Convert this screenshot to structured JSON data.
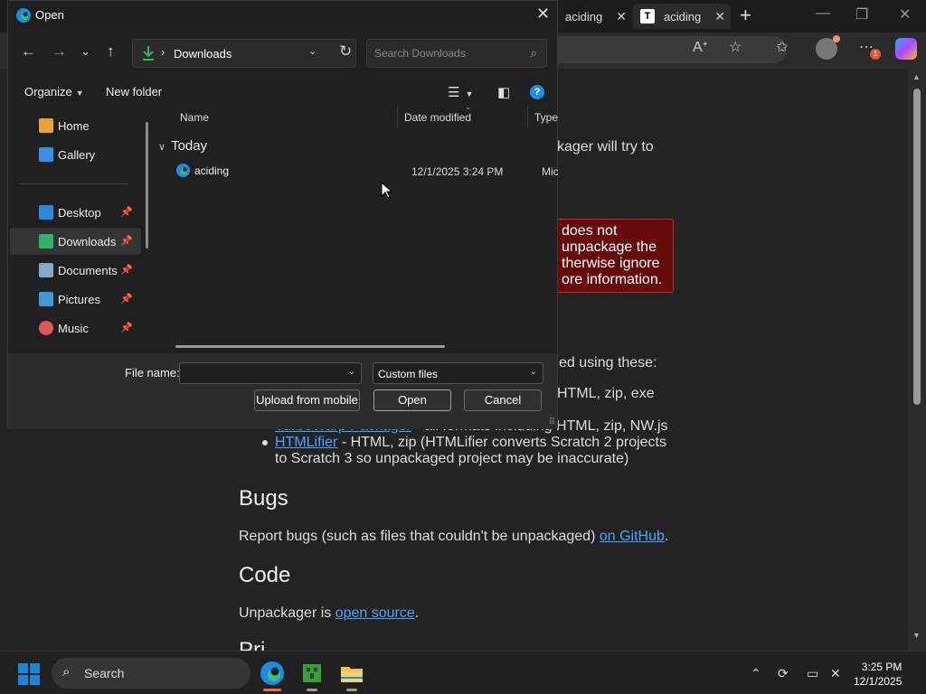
{
  "browser": {
    "tabs": [
      {
        "label": "aciding"
      },
      {
        "label": "aciding"
      }
    ],
    "new_tab": "+",
    "window_controls": {
      "minimize": "—",
      "maximize": "❐",
      "close": "✕"
    },
    "toolbar_icons": [
      "read-aloud-icon",
      "favorite-star-icon",
      "favorites-icon",
      "profile-icon",
      "more-icon",
      "copilot-icon"
    ],
    "notification_count": "1",
    "page": {
      "line1": "kager will try to",
      "warning_lines": [
        "does not",
        "unpackage the",
        "therwise ignore",
        "ore information."
      ],
      "used_using": "ed using these:",
      "list_fragment1": "HTML, zip, exe",
      "list_item2_link": "TurboWarp Packager",
      "list_item2_text": " - all formats including HTML, zip, NW.js",
      "list_item3_link": "HTMLifier",
      "list_item3_text": " - HTML, zip (HTMLifier converts Scratch 2 projects",
      "list_item3_text2": "to Scratch 3 so unpackaged project may be inaccurate)",
      "bugs_heading": "Bugs",
      "bugs_text": "Report bugs (such as files that couldn't be unpackaged) ",
      "bugs_link": "on GitHub",
      "bugs_end": ".",
      "code_heading": "Code",
      "code_text": "Unpackager is ",
      "code_link": "open source",
      "code_end": ".",
      "next_heading_fragment": "Pri"
    }
  },
  "dialog": {
    "title": "Open",
    "close": "✕",
    "nav": {
      "back": "←",
      "forward": "→",
      "recent": "⌄",
      "up": "↑"
    },
    "path": {
      "chevron": "›",
      "folder": "Downloads",
      "dropdown": "⌄",
      "refresh": "↻"
    },
    "search": {
      "placeholder": "Search Downloads"
    },
    "commands": {
      "organize": "Organize",
      "new_folder": "New folder"
    },
    "nav_pane": [
      {
        "label": "Home",
        "icon": "home-icon",
        "color": "#e8a33c",
        "pinned": false
      },
      {
        "label": "Gallery",
        "icon": "gallery-icon",
        "color": "#3a8ee6",
        "pinned": false
      },
      {
        "label": "Desktop",
        "icon": "desktop-icon",
        "color": "#2b8ae0",
        "pinned": true
      },
      {
        "label": "Downloads",
        "icon": "downloads-icon",
        "color": "#2fb36a",
        "pinned": true,
        "selected": true
      },
      {
        "label": "Documents",
        "icon": "documents-icon",
        "color": "#8aa6c8",
        "pinned": true
      },
      {
        "label": "Pictures",
        "icon": "pictures-icon",
        "color": "#3a9ad9",
        "pinned": true
      },
      {
        "label": "Music",
        "icon": "music-icon",
        "color": "#e0565a",
        "pinned": true
      }
    ],
    "columns": {
      "name": "Name",
      "date": "Date modified",
      "type": "Type"
    },
    "group": "Today",
    "files": [
      {
        "name": "aciding",
        "date": "12/1/2025 3:24 PM",
        "type": "Micro"
      }
    ],
    "file_name_label": "File name:",
    "file_name_value": "",
    "filter": "Custom files",
    "buttons": {
      "upload": "Upload from mobile",
      "open": "Open",
      "cancel": "Cancel"
    }
  },
  "taskbar": {
    "search_label": "Search",
    "apps": [
      "edge-icon",
      "minecraft-icon",
      "file-explorer-icon"
    ],
    "time": "3:25 PM",
    "date": "12/1/2025"
  }
}
